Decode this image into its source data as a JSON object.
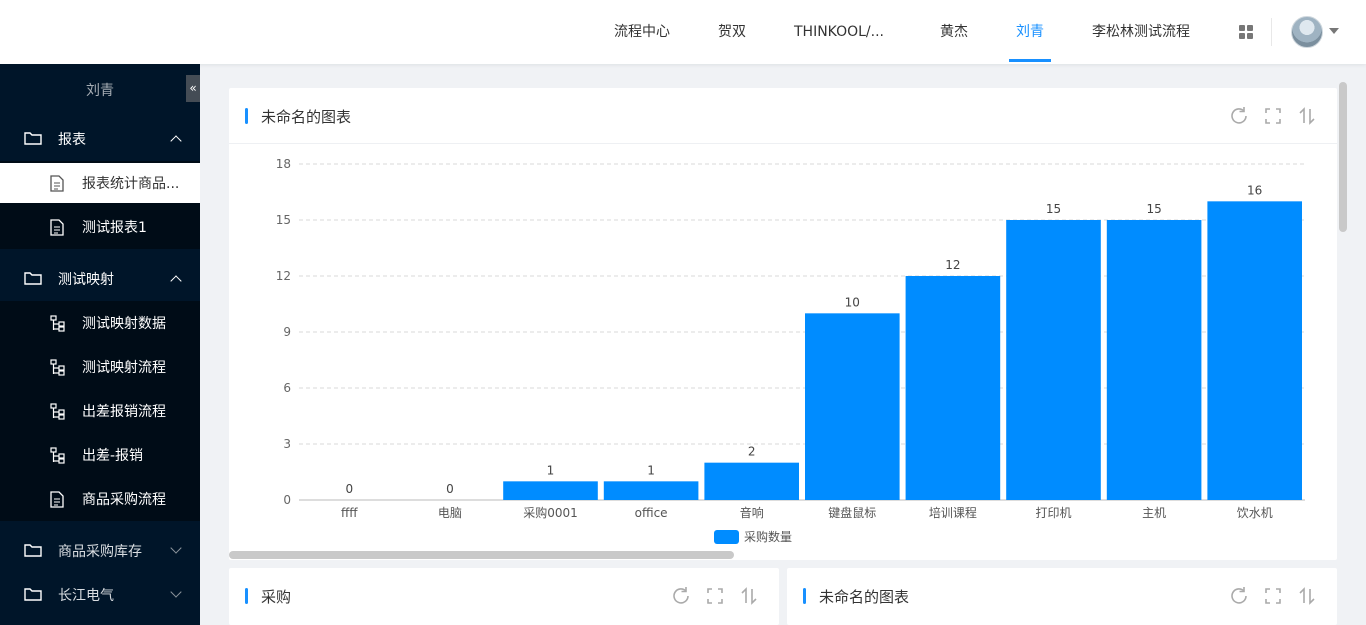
{
  "top_nav": {
    "tabs": [
      {
        "label": "流程中心",
        "active": false
      },
      {
        "label": "贺双",
        "active": false
      },
      {
        "label": "THINKOOL/...",
        "active": false
      },
      {
        "label": "黄杰",
        "active": false
      },
      {
        "label": "刘青",
        "active": true
      },
      {
        "label": "李松林测试流程",
        "active": false
      }
    ],
    "apps_icon": "grid-icon",
    "avatar_icon": "user-avatar"
  },
  "sidebar": {
    "user_name": "刘青",
    "collapse_label": "«",
    "groups": [
      {
        "label": "报表",
        "expanded": true,
        "items": [
          {
            "label": "报表统计商品...",
            "icon": "document-icon",
            "active": true
          },
          {
            "label": "测试报表1",
            "icon": "document-icon",
            "active": false
          }
        ]
      },
      {
        "label": "测试映射",
        "expanded": true,
        "items": [
          {
            "label": "测试映射数据",
            "icon": "tree-icon",
            "active": false
          },
          {
            "label": "测试映射流程",
            "icon": "tree-icon",
            "active": false
          },
          {
            "label": "出差报销流程",
            "icon": "tree-icon",
            "active": false
          },
          {
            "label": "出差-报销",
            "icon": "tree-icon",
            "active": false
          },
          {
            "label": "商品采购流程",
            "icon": "document-icon",
            "active": false
          }
        ]
      },
      {
        "label": "商品采购库存",
        "expanded": false,
        "items": []
      },
      {
        "label": "长江电气",
        "expanded": false,
        "items": []
      }
    ]
  },
  "main_card": {
    "title": "未命名的图表",
    "tools": [
      "refresh-icon",
      "fullscreen-icon",
      "sort-icon"
    ]
  },
  "bottom_cards": [
    {
      "title": "采购"
    },
    {
      "title": "未命名的图表"
    }
  ],
  "chart_data": {
    "type": "bar",
    "title": "",
    "categories": [
      "ffff",
      "电脑",
      "采购0001",
      "office",
      "音响",
      "键盘鼠标",
      "培训课程",
      "打印机",
      "主机",
      "饮水机"
    ],
    "series": [
      {
        "name": "采购数量",
        "values": [
          0,
          0,
          1,
          1,
          2,
          10,
          12,
          15,
          15,
          16
        ],
        "color": "#008cff"
      }
    ],
    "yticks": [
      0,
      3,
      6,
      9,
      12,
      15,
      18
    ],
    "ylim": [
      0,
      18
    ],
    "grid": true,
    "legend": "bottom-center",
    "data_labels": true
  }
}
